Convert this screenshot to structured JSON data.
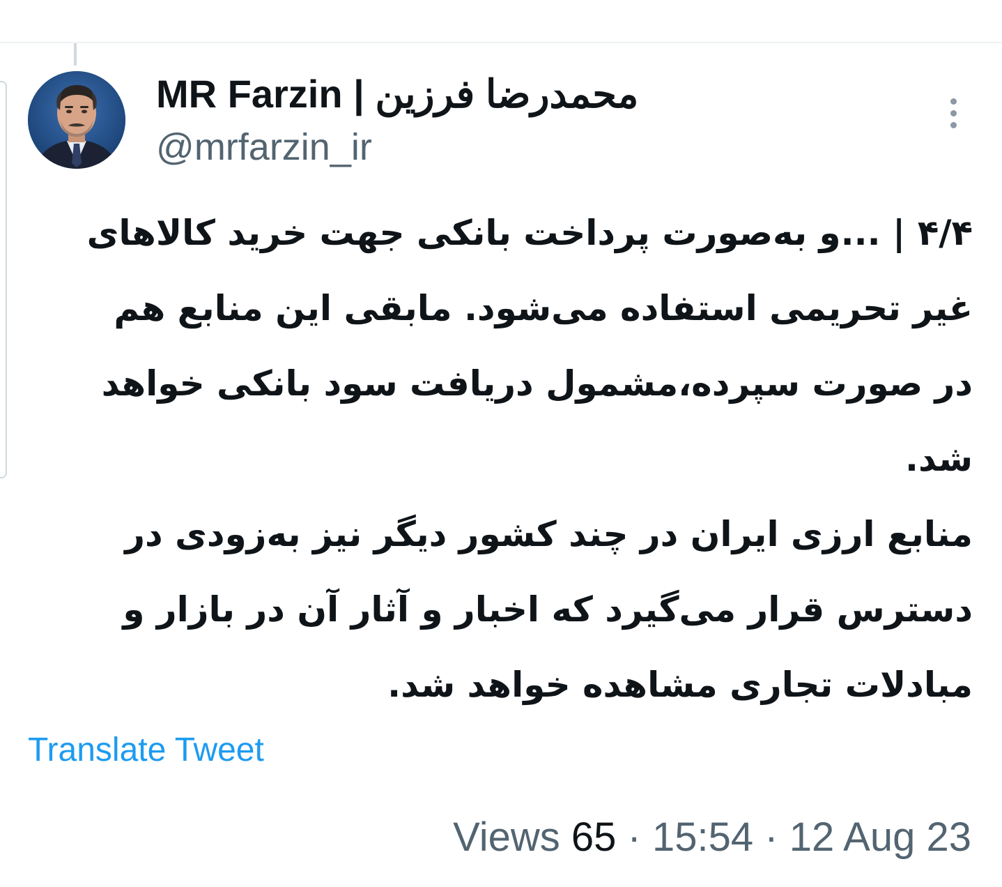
{
  "author": {
    "display_name": "MR Farzin | محمدرضا فرزین",
    "handle": "@mrfarzin_ir",
    "avatar_icon": "profile-photo"
  },
  "tweet": {
    "paragraphs": [
      "۴/۴ | ...و به‌صورت پرداخت بانکی جهت خرید کالاهای غیر تحریمی استفاده می‌شود. مابقی این منابع هم در صورت سپرده،مشمول دریافت سود بانکی خواهد شد.",
      "منابع ارزی ایران در چند کشور دیگر نیز به‌زودی در دسترس قرار می‌گیرد که اخبار و آثار آن در بازار و مبادلات تجاری مشاهده خواهد شد."
    ],
    "translate_label": "Translate Tweet"
  },
  "meta": {
    "views_label": "Views",
    "views_count": "65",
    "separator": "·",
    "time": "15:54",
    "date": "12 Aug 23"
  },
  "colors": {
    "text": "#0f1419",
    "secondary": "#536471",
    "link": "#1d9bf0",
    "divider": "#eff3f4"
  },
  "icons": {
    "more": "more-options-icon"
  }
}
